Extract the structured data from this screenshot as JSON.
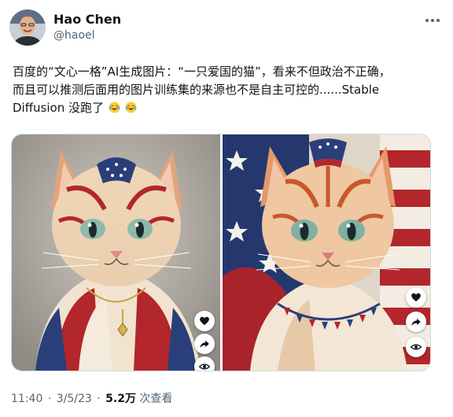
{
  "author": {
    "name": "Hao Chen",
    "handle": "@haoel"
  },
  "tweet": {
    "line1": "百度的“文心一格”AI生成图片：“一只爱国的猫”，看来不但政治不正确，",
    "line2": "而且可以推测后面用的图片训练集的来源也不是自主可控的......Stable",
    "line3": "Diffusion 没跑了",
    "emojis": [
      "laughing-tears-emoji",
      "laughing-tears-emoji"
    ]
  },
  "media": {
    "images": [
      {
        "icon": "cat-american-flag-image"
      },
      {
        "icon": "cat-american-flag-background-image"
      }
    ],
    "overlay_buttons": [
      "heart-icon",
      "share-icon",
      "eye-icon"
    ]
  },
  "meta": {
    "time": "11:40",
    "separator": "·",
    "date": "3/5/23",
    "views_count": "5.2万",
    "views_label": "次查看"
  },
  "colors": {
    "text": "#0f1419",
    "secondary": "#536471",
    "border": "#cfd9de",
    "flag_red": "#b3262c",
    "flag_blue": "#2a3f7a"
  }
}
